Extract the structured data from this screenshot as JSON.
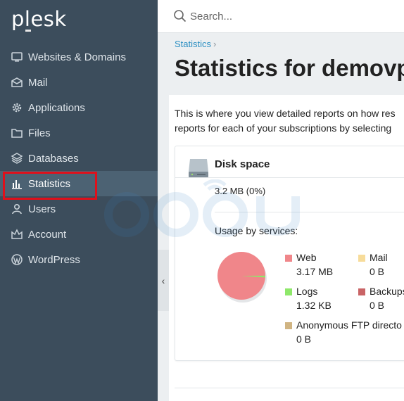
{
  "app": {
    "logo": "plesk"
  },
  "sidebar": {
    "items": [
      {
        "label": "Websites & Domains",
        "icon": "monitor-icon"
      },
      {
        "label": "Mail",
        "icon": "mail-icon"
      },
      {
        "label": "Applications",
        "icon": "gear-icon"
      },
      {
        "label": "Files",
        "icon": "folder-icon"
      },
      {
        "label": "Databases",
        "icon": "database-layers-icon"
      },
      {
        "label": "Statistics",
        "icon": "bar-chart-icon",
        "active": true
      },
      {
        "label": "Users",
        "icon": "user-icon"
      },
      {
        "label": "Account",
        "icon": "account-icon"
      },
      {
        "label": "WordPress",
        "icon": "wordpress-icon"
      }
    ],
    "collapse_glyph": "‹"
  },
  "search": {
    "placeholder": "Search..."
  },
  "header": {
    "breadcrumb": "Statistics",
    "breadcrumb_sep": "›",
    "title": "Statistics for demovp"
  },
  "main": {
    "description_line1": "This is where you view detailed reports on how res",
    "description_line2": "reports for each of your subscriptions by selecting",
    "disk": {
      "title": "Disk space",
      "value": "3.2 MB (0%)",
      "usage_label": "Usage by services:"
    },
    "legend": [
      {
        "name": "Web",
        "value": "3.17 MB",
        "color": "#f0868a"
      },
      {
        "name": "Mail",
        "value": "0 B",
        "color": "#f7dc9a"
      },
      {
        "name": "Logs",
        "value": "1.32 KB",
        "color": "#8ee86a"
      },
      {
        "name": "Backups",
        "value": "0 B",
        "color": "#c96466"
      },
      {
        "name": "Anonymous FTP directo",
        "value": "0 B",
        "color": "#d0b482"
      }
    ]
  },
  "chart_data": {
    "type": "pie",
    "title": "",
    "slices": [
      {
        "name": "Web",
        "value": 3.17,
        "unit": "MB",
        "color": "#f0868a"
      },
      {
        "name": "Mail",
        "value": 0,
        "unit": "B",
        "color": "#f7dc9a"
      },
      {
        "name": "Logs",
        "value": 1.32,
        "unit": "KB",
        "color": "#8ee86a"
      },
      {
        "name": "Backups",
        "value": 0,
        "unit": "B",
        "color": "#c96466"
      },
      {
        "name": "Anonymous FTP directo",
        "value": 0,
        "unit": "B",
        "color": "#d0b482"
      }
    ]
  },
  "colors": {
    "sidebar_bg": "#3c4d5c",
    "sidebar_active": "#4c6273",
    "highlight_red": "#e0101b",
    "link_blue": "#2a8ec2"
  }
}
